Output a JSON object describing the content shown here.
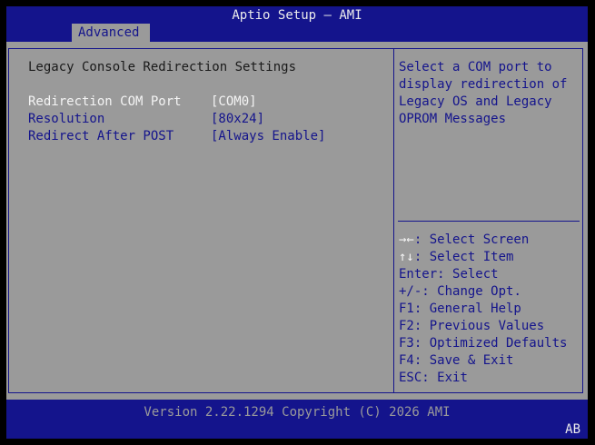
{
  "header": {
    "title": "Aptio Setup – AMI",
    "active_tab": "Advanced"
  },
  "main": {
    "section_title": "Legacy Console Redirection Settings",
    "options": [
      {
        "label": "Redirection COM Port",
        "value": "[COM0]",
        "selected": true
      },
      {
        "label": "Resolution",
        "value": "[80x24]",
        "selected": false
      },
      {
        "label": "Redirect After POST",
        "value": "[Always Enable]",
        "selected": false
      }
    ]
  },
  "help": {
    "lines": [
      "Select a COM port to",
      "display redirection of",
      "Legacy OS and Legacy",
      "OPROM Messages"
    ]
  },
  "keys": [
    {
      "key": "→←",
      "desc": ": Select Screen"
    },
    {
      "key": "↑↓",
      "desc": ": Select Item"
    },
    {
      "key": "Enter",
      "desc": ": Select"
    },
    {
      "key": "+/-",
      "desc": ": Change Opt."
    },
    {
      "key": "F1",
      "desc": ": General Help"
    },
    {
      "key": "F2",
      "desc": ": Previous Values"
    },
    {
      "key": "F3",
      "desc": ": Optimized Defaults"
    },
    {
      "key": "F4",
      "desc": ": Save & Exit"
    },
    {
      "key": "ESC",
      "desc": ": Exit"
    }
  ],
  "footer": {
    "version": "Version 2.22.1294 Copyright (C) 2026 AMI",
    "badge": "AB"
  },
  "colors": {
    "bar_blue": "#14148c",
    "panel_gray": "#9a9a9a",
    "highlight_white": "#f4f4f4"
  }
}
